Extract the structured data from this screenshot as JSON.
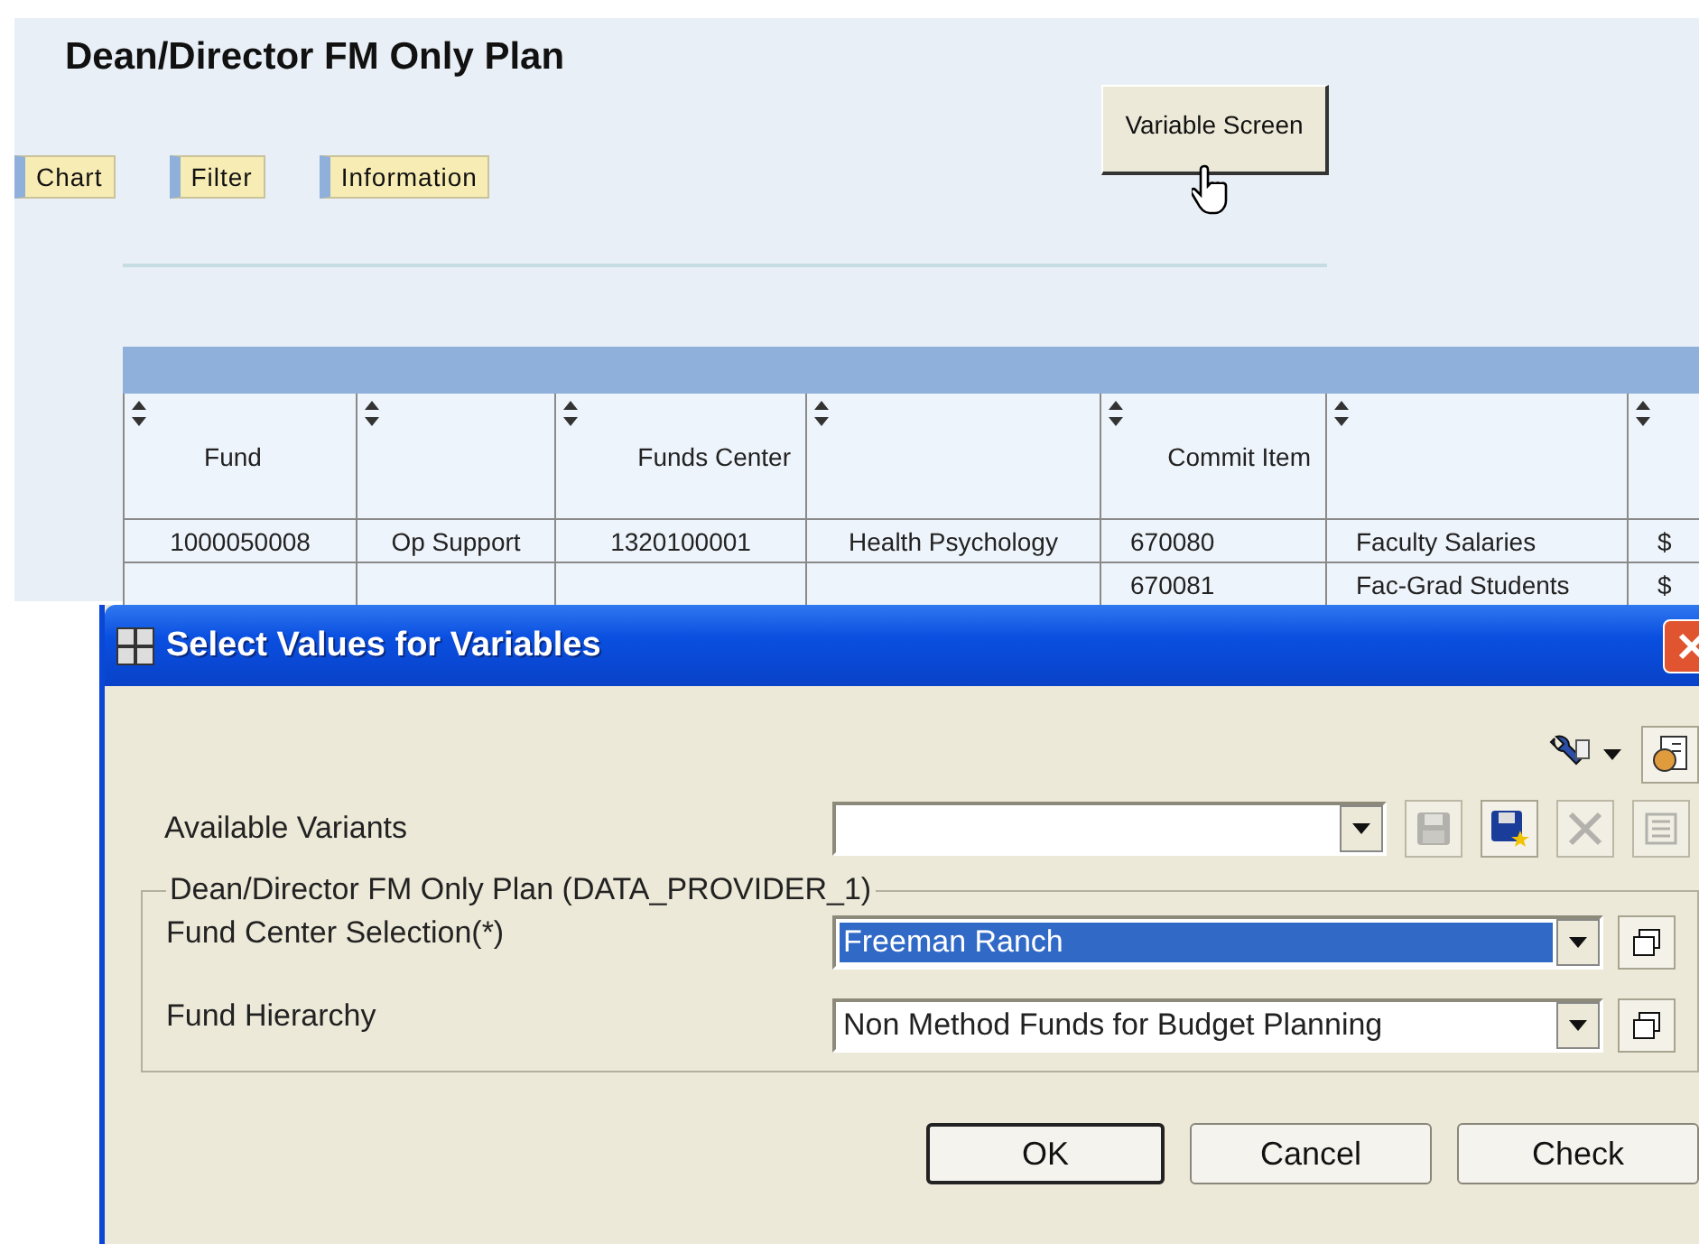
{
  "report": {
    "title": "Dean/Director FM Only Plan",
    "tab_buttons": [
      "Chart",
      "Filter",
      "Information"
    ],
    "variable_button": "Variable Screen",
    "table": {
      "columns": [
        "Fund",
        null,
        "Funds Center",
        null,
        "Commit Item",
        null,
        null
      ],
      "rows": [
        [
          "1000050008",
          "Op Support",
          "1320100001",
          "Health Psychology",
          "670080",
          "Faculty Salaries",
          "$"
        ],
        [
          null,
          null,
          null,
          null,
          "670081",
          "Fac-Grad Students",
          "$"
        ]
      ]
    }
  },
  "dialog": {
    "title": "Select Values for Variables",
    "variants_label": "Available Variants",
    "variant_buttons": [
      {
        "kind": "save",
        "disabled": true
      },
      {
        "kind": "save-as",
        "disabled": false
      },
      {
        "kind": "delete",
        "disabled": true
      },
      {
        "kind": "details",
        "disabled": true
      }
    ],
    "group_title": "Dean/Director FM Only Plan (DATA_PROVIDER_1)",
    "variables": [
      {
        "label": "Fund Center Selection(*)",
        "value": "Freeman Ranch",
        "highlighted": true
      },
      {
        "label": "Fund Hierarchy",
        "value": "Non Method Funds for Budget Planning",
        "highlighted": false
      }
    ],
    "buttons": [
      {
        "label": "OK",
        "default": true
      },
      {
        "label": "Cancel",
        "default": false
      },
      {
        "label": "Check",
        "default": false
      }
    ]
  }
}
